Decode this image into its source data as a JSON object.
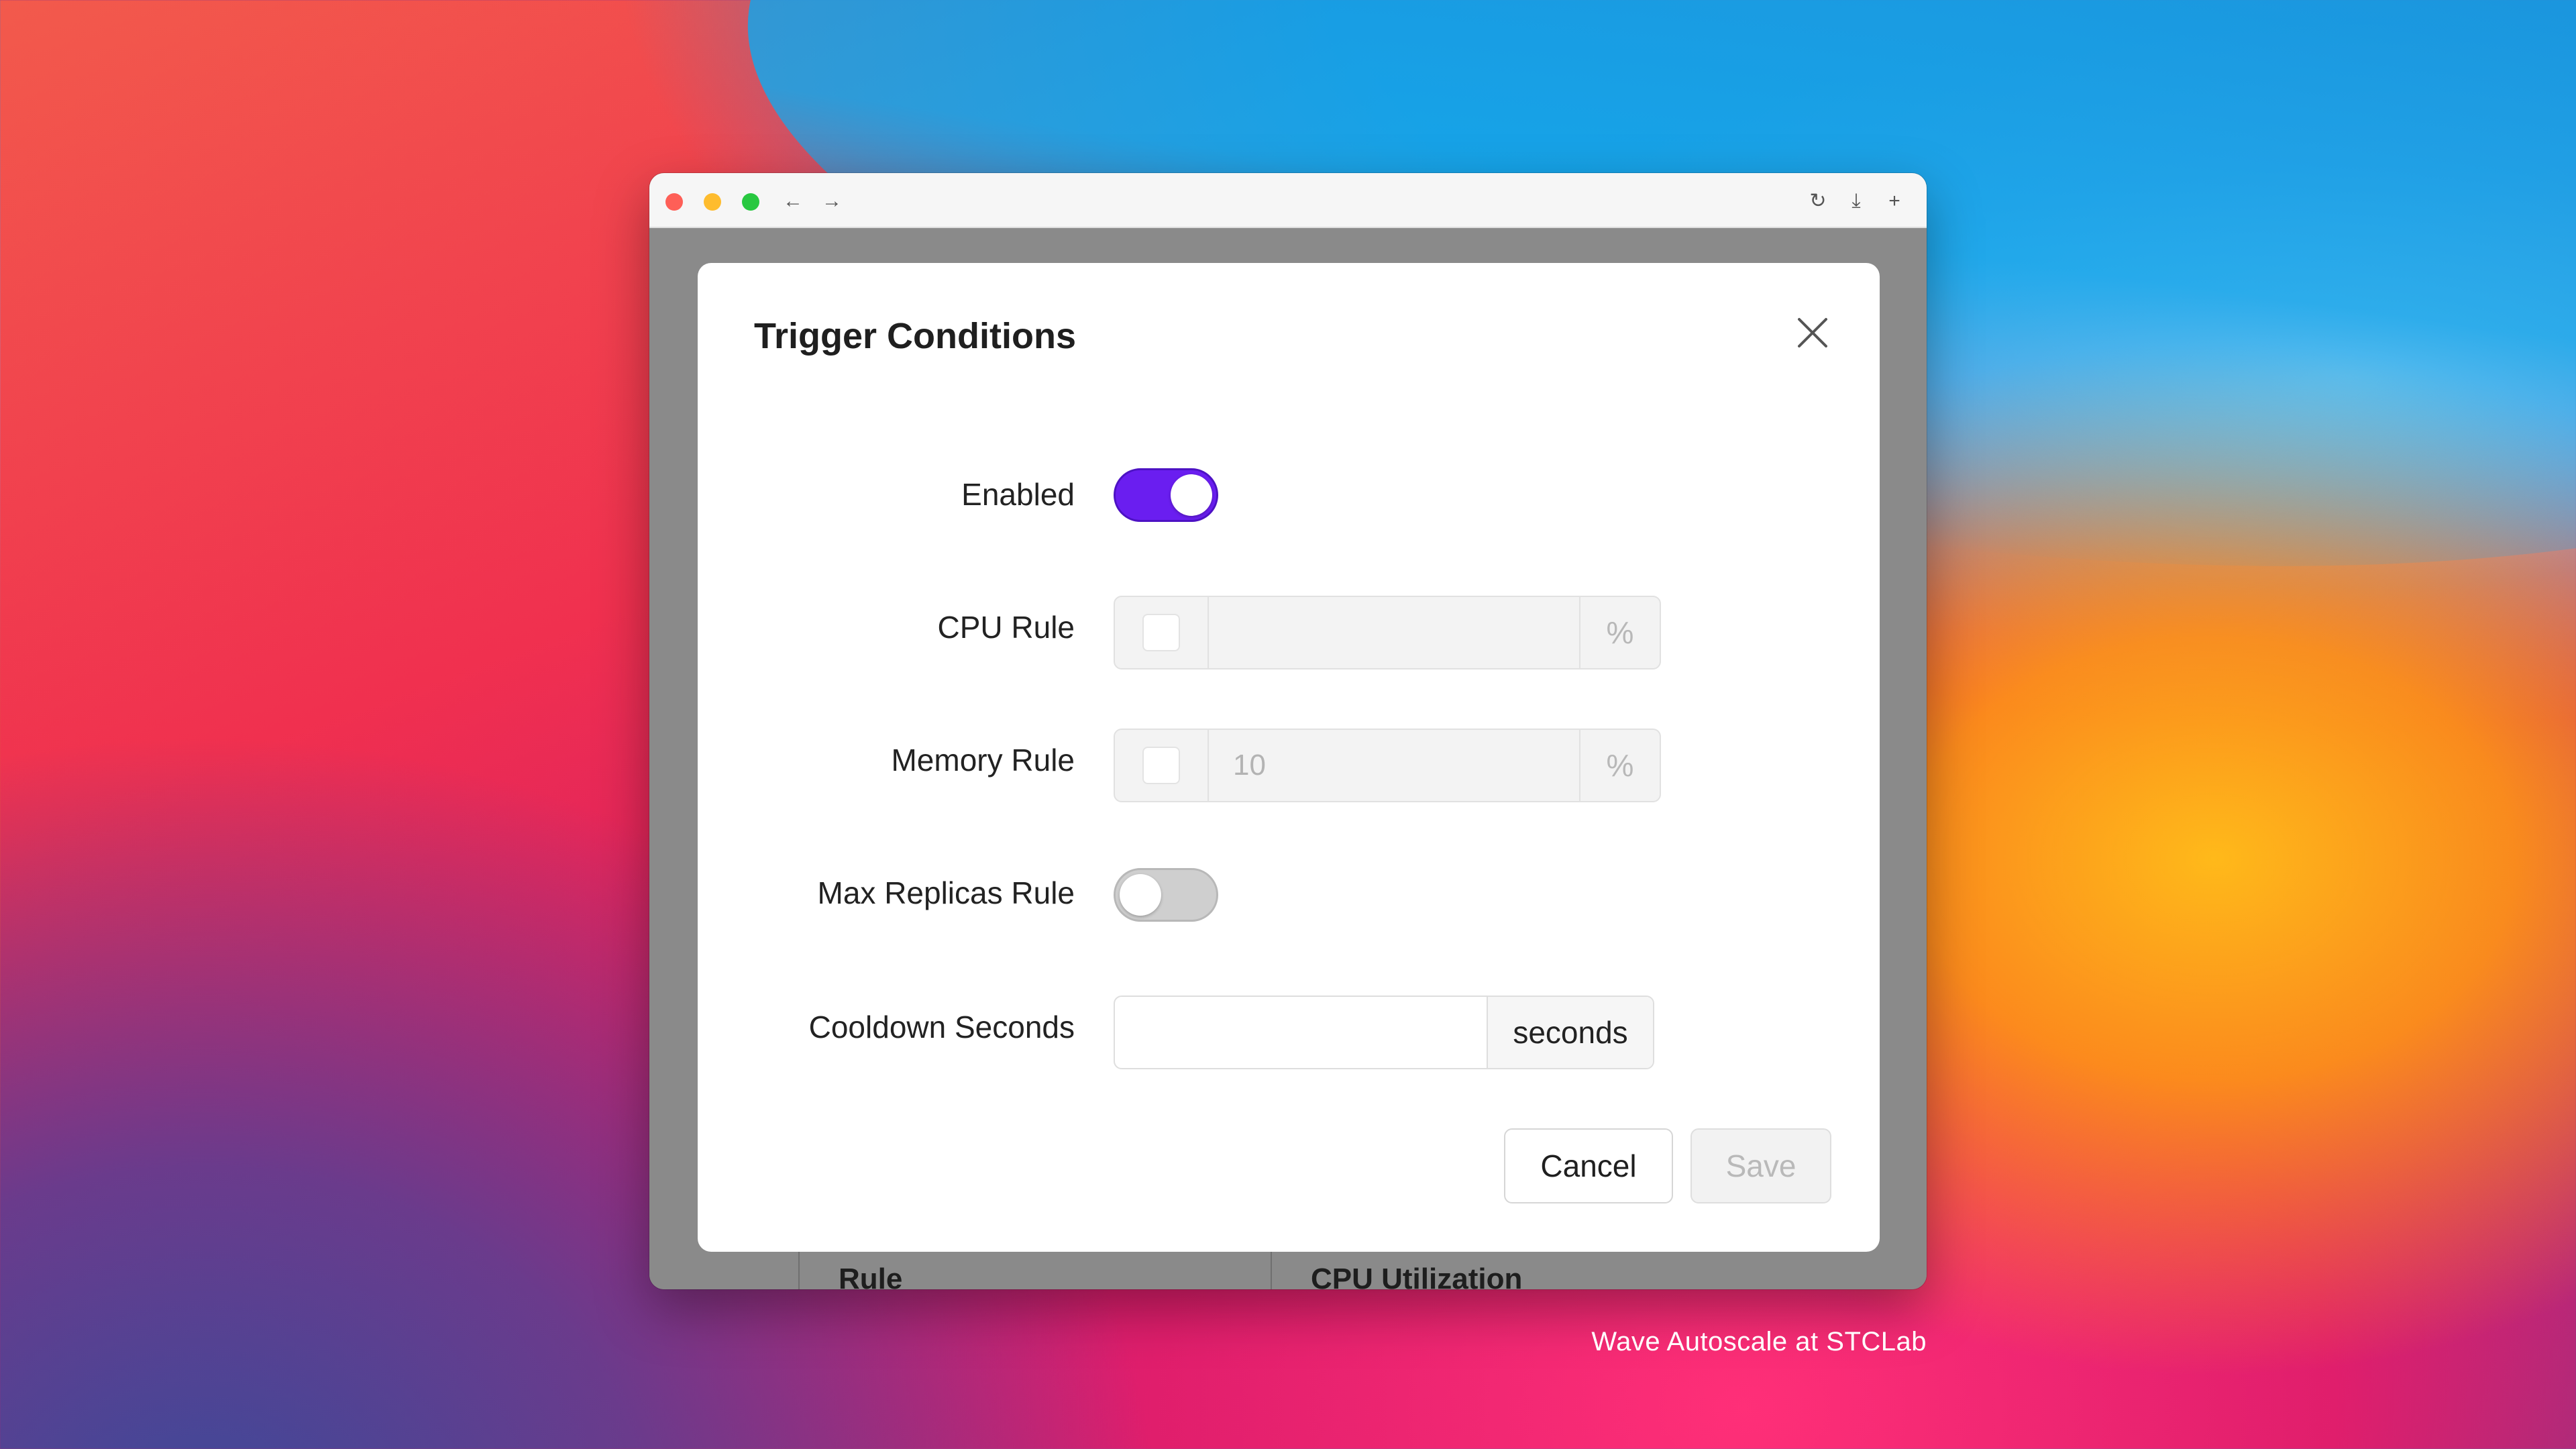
{
  "desktop": {
    "caption": "Wave Autoscale at STCLab"
  },
  "browser": {
    "icons": {
      "back": "arrow-left-icon",
      "forward": "arrow-right-icon",
      "reload": "reload-icon",
      "download": "download-icon",
      "add": "plus-icon"
    },
    "glyphs": {
      "back": "←",
      "forward": "→",
      "reload": "↻",
      "download": "⤓",
      "add": "+"
    }
  },
  "background_table": {
    "columns": [
      "Rule",
      "CPU Utilization"
    ]
  },
  "dialog": {
    "title": "Trigger Conditions",
    "fields": {
      "enabled": {
        "label": "Enabled",
        "on": true
      },
      "cpu_rule": {
        "label": "CPU Rule",
        "checked": false,
        "value": "",
        "unit": "%"
      },
      "memory_rule": {
        "label": "Memory Rule",
        "checked": false,
        "value": "10",
        "unit": "%"
      },
      "max_replicas_rule": {
        "label": "Max Replicas Rule",
        "on": false
      },
      "cooldown_seconds": {
        "label": "Cooldown Seconds",
        "value": "",
        "unit": "seconds"
      }
    },
    "buttons": {
      "cancel": "Cancel",
      "save": "Save"
    }
  },
  "colors": {
    "toggle_on": "#6a1ef0",
    "toggle_off": "#cfcfcf",
    "close_red": "#fe5f57",
    "minimize_yellow": "#febc2e",
    "maximize_green": "#28c840"
  }
}
